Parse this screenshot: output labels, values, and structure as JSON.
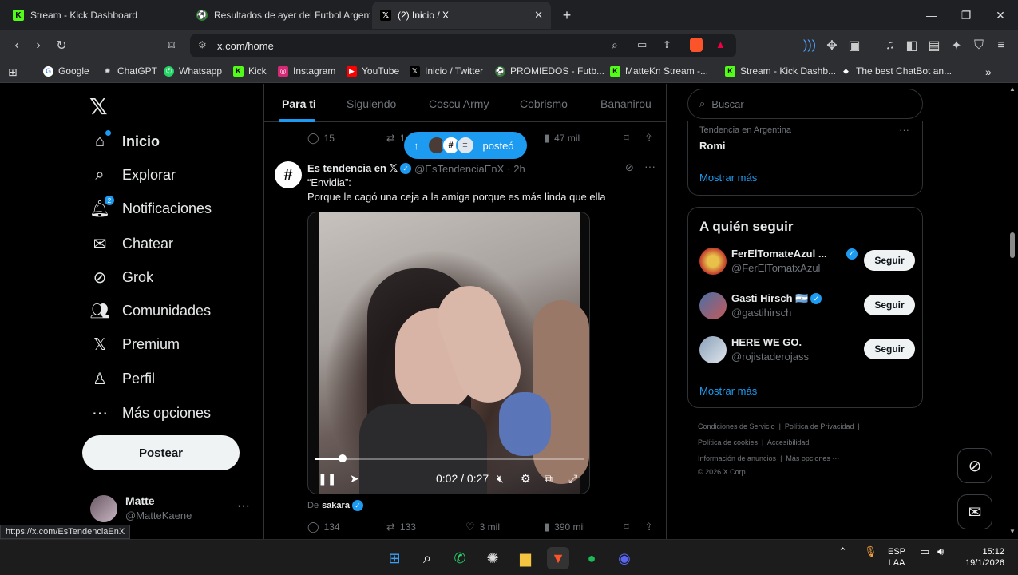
{
  "browser": {
    "tabs": [
      {
        "title": "Stream - Kick Dashboard"
      },
      {
        "title": "Resultados de ayer del Futbol Argent"
      },
      {
        "title": "(2) Inicio / X"
      }
    ],
    "url": "x.com/home",
    "bookmarks": [
      "Google",
      "ChatGPT",
      "Whatsapp",
      "Kick",
      "Instagram",
      "YouTube",
      "Inicio / Twitter",
      "PROMIEDOS - Futb...",
      "MatteKn Stream -...",
      "Stream - Kick Dashb...",
      "The best ChatBot an..."
    ],
    "status_url": "https://x.com/EsTendenciaEnX"
  },
  "nav": {
    "items": [
      "Inicio",
      "Explorar",
      "Notificaciones",
      "Chatear",
      "Grok",
      "Comunidades",
      "Premium",
      "Perfil",
      "Más opciones"
    ],
    "notif_badge": "2",
    "post_label": "Postear"
  },
  "profile": {
    "name": "Matte",
    "handle": "@MatteKaene"
  },
  "feed": {
    "tabs": [
      "Para ti",
      "Siguiendo",
      "Coscu Army",
      "Cobrismo",
      "Bananirou"
    ],
    "prev_actions": {
      "replies": "15",
      "reposts": "1",
      "views": "47 mil"
    },
    "new_posts_label": "posteó",
    "tweet": {
      "name": "Es tendencia en 𝕏",
      "handle": "@EsTendenciaEnX",
      "time": "· 2h",
      "line1": "“Envidia”:",
      "line2": "Porque le cagó una ceja a la amiga porque es más linda que ella",
      "video_time": "0:02 / 0:27",
      "source_prefix": "De",
      "source_name": "sakara",
      "replies": "134",
      "reposts": "133",
      "likes": "3 mil",
      "views": "390 mil"
    }
  },
  "sidebar": {
    "search_placeholder": "Buscar",
    "trend_sub": "Tendencia en Argentina",
    "trend_name": "Romi",
    "show_more": "Mostrar más",
    "who_title": "A quién seguir",
    "who": [
      {
        "name": "FerElTomateAzul ...",
        "handle": "@FerElTomatxAzul"
      },
      {
        "name": "Gasti Hirsch 🇦🇷",
        "handle": "@gastihirsch"
      },
      {
        "name": "HERE WE GO.",
        "handle": "@rojistaderojass"
      }
    ],
    "follow_label": "Seguir",
    "footer": {
      "l1a": "Condiciones de Servicio",
      "l1b": "Política de Privacidad",
      "l2a": "Política de cookies",
      "l2b": "Accesibilidad",
      "l3a": "Información de anuncios",
      "l3b": "Más opciones ···",
      "l4": "© 2026 X Corp."
    }
  },
  "taskbar": {
    "lang1": "ESP",
    "lang2": "LAA",
    "time": "15:12",
    "date": "19/1/2026"
  },
  "colors": {
    "accent": "#1d9bf0",
    "bg": "#000000",
    "border": "#2f3336",
    "muted": "#71767b"
  }
}
